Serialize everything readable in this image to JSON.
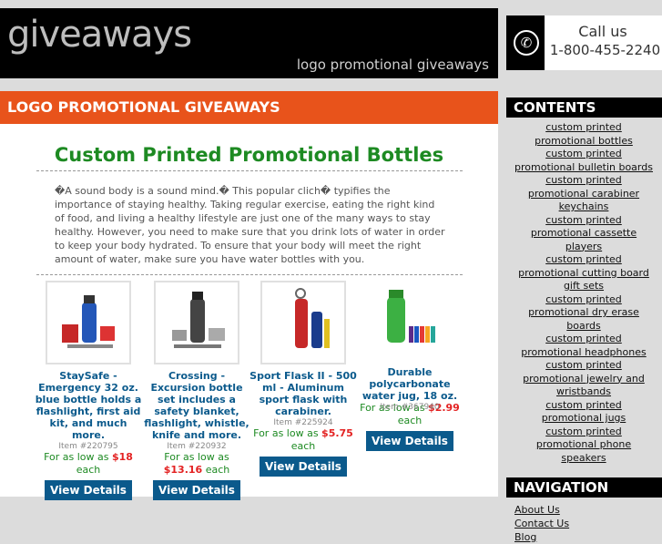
{
  "header": {
    "logo": "giveaways",
    "tagline": "logo promotional giveaways"
  },
  "call": {
    "line1": "Call us",
    "line2": "1-800-455-2240",
    "icon": "phone-icon"
  },
  "bar": {
    "title": "LOGO PROMOTIONAL GIVEAWAYS"
  },
  "main": {
    "title": "Custom Printed Promotional Bottles",
    "intro": "�A sound body is a sound mind.� This popular clich� typifies the importance of staying healthy. Taking regular exercise, eating the right kind of food, and living a healthy lifestyle are just one of the many ways to stay healthy. However, you need to make sure that you drink lots of water in order to keep your body hydrated. To ensure that your body will meet the right amount of water, make sure you have water bottles with you."
  },
  "products": [
    {
      "name": "StaySafe - Emergency 32 oz. blue bottle holds a flashlight, first aid kit, and much more.",
      "item": "Item #220795",
      "low": "For as low as",
      "price": "$18",
      "each": "each",
      "button": "View Details"
    },
    {
      "name": "Crossing - Excursion bottle set includes a safety blanket, flashlight, whistle, knife and more.",
      "item": "Item #220932",
      "low": "For as low as",
      "price": "$13.16",
      "each": "each",
      "button": "View Details"
    },
    {
      "name": "Sport Flask II - 500 ml - Aluminum sport flask with carabiner.",
      "item": "Item #225924",
      "low": "For as low as",
      "price": "$5.75",
      "each": "each",
      "button": "View Details"
    },
    {
      "name": "Durable polycarbonate water jug, 18 oz.",
      "item": "Item #367940",
      "low": "For as low as",
      "price": "$2.99",
      "each": "each",
      "button": "View Details"
    }
  ],
  "sidebar": {
    "contents_title": "CONTENTS",
    "contents": [
      "custom printed promotional bottles",
      "custom printed promotional bulletin boards",
      "custom printed promotional carabiner keychains",
      "custom printed promotional cassette players",
      "custom printed promotional cutting board gift sets",
      "custom printed promotional dry erase boards",
      "custom printed promotional headphones",
      "custom printed promotional jewelry and wristbands",
      "custom printed promotional jugs",
      "custom printed promotional phone speakers"
    ],
    "nav_title": "NAVIGATION",
    "nav": [
      "About Us",
      "Contact Us",
      "Blog"
    ]
  }
}
